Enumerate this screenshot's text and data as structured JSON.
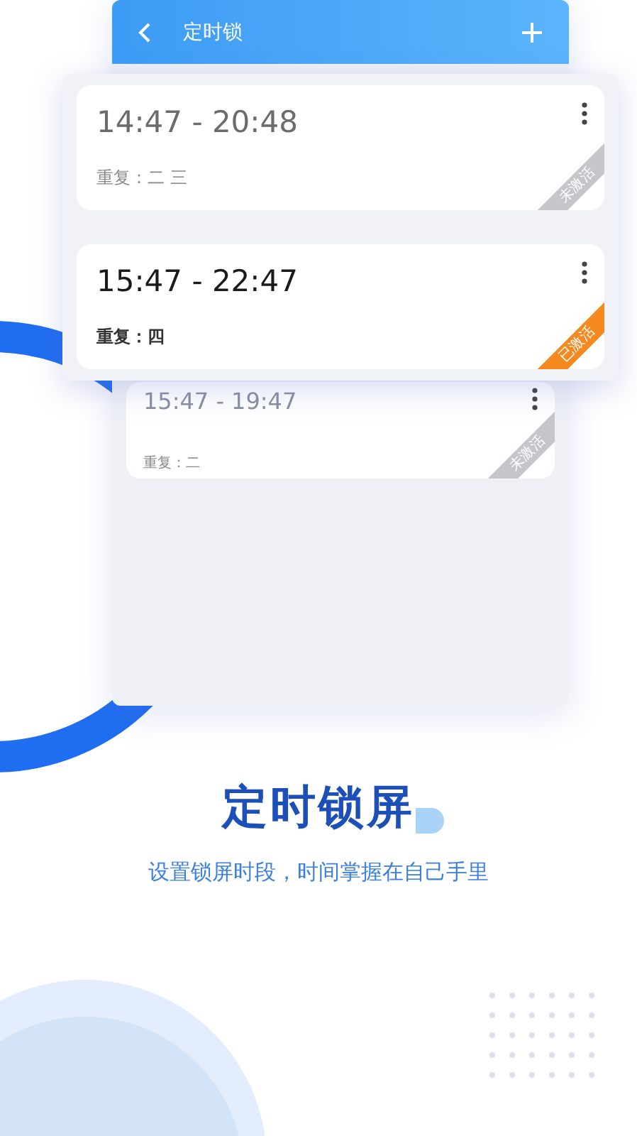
{
  "app_screen": {
    "title": "定时锁",
    "cards": [
      {
        "time": "15:47 - 19:47",
        "repeat": "重复：二",
        "active": false,
        "badge": "未激活"
      }
    ]
  },
  "popup_cards": [
    {
      "time": "14:47 - 20:48",
      "repeat": "重复：二 三",
      "active": false,
      "badge": "未激活"
    },
    {
      "time": "15:47 - 22:47",
      "repeat": "重复：四",
      "active": true,
      "badge": "已激活"
    }
  ],
  "headline": "定时锁屏",
  "subtitle": "设置锁屏时段，时间掌握在自己手里"
}
